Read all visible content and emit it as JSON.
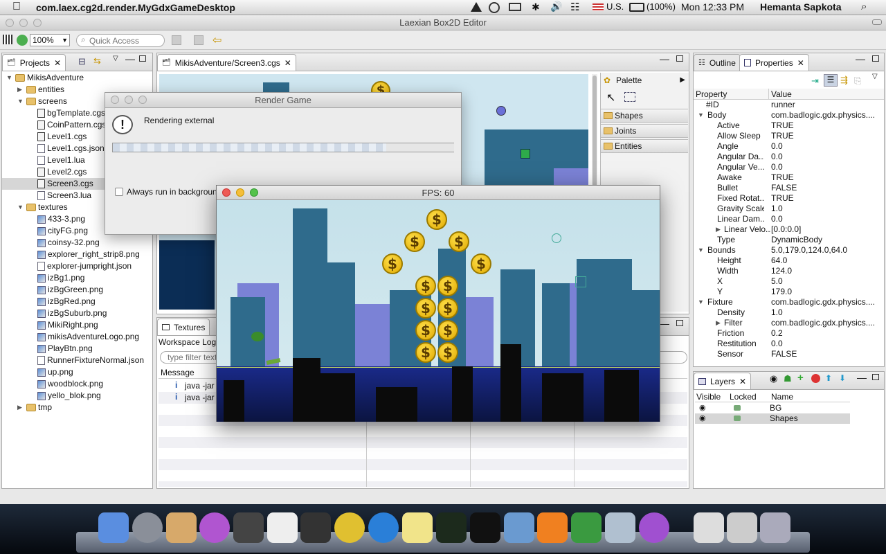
{
  "menubar": {
    "app_name": "com.laex.cg2d.render.MyGdxGameDesktop",
    "input_source": "U.S.",
    "battery": "(100%)",
    "clock": "Mon 12:33 PM",
    "user": "Hemanta Sapkota"
  },
  "window": {
    "title": "Laexian Box2D Editor"
  },
  "toolbar": {
    "zoom": "100%",
    "quick_access_placeholder": "Quick Access"
  },
  "projects": {
    "tab": "Projects",
    "tree": [
      {
        "label": "MikisAdventure",
        "level": 0,
        "type": "project",
        "expanded": true
      },
      {
        "label": "entities",
        "level": 1,
        "type": "folder",
        "expanded": false
      },
      {
        "label": "screens",
        "level": 1,
        "type": "folder",
        "expanded": true
      },
      {
        "label": "bgTemplate.cgs",
        "level": 2,
        "type": "cgs"
      },
      {
        "label": "CoinPattern.cgs",
        "level": 2,
        "type": "cgs"
      },
      {
        "label": "Level1.cgs",
        "level": 2,
        "type": "cgs"
      },
      {
        "label": "Level1.cgs.json",
        "level": 2,
        "type": "file"
      },
      {
        "label": "Level1.lua",
        "level": 2,
        "type": "file"
      },
      {
        "label": "Level2.cgs",
        "level": 2,
        "type": "cgs"
      },
      {
        "label": "Screen3.cgs",
        "level": 2,
        "type": "cgs",
        "selected": true
      },
      {
        "label": "Screen3.lua",
        "level": 2,
        "type": "file"
      },
      {
        "label": "textures",
        "level": 1,
        "type": "folder",
        "expanded": true
      },
      {
        "label": "433-3.png",
        "level": 2,
        "type": "image"
      },
      {
        "label": "cityFG.png",
        "level": 2,
        "type": "image"
      },
      {
        "label": "coinsy-32.png",
        "level": 2,
        "type": "image"
      },
      {
        "label": "explorer_right_strip8.png",
        "level": 2,
        "type": "image"
      },
      {
        "label": "explorer-jumpright.json",
        "level": 2,
        "type": "file"
      },
      {
        "label": "izBg1.png",
        "level": 2,
        "type": "image"
      },
      {
        "label": "izBgGreen.png",
        "level": 2,
        "type": "image"
      },
      {
        "label": "izBgRed.png",
        "level": 2,
        "type": "image"
      },
      {
        "label": "izBgSuburb.png",
        "level": 2,
        "type": "image"
      },
      {
        "label": "MikiRight.png",
        "level": 2,
        "type": "image"
      },
      {
        "label": "mikisAdventureLogo.png",
        "level": 2,
        "type": "image"
      },
      {
        "label": "PlayBtn.png",
        "level": 2,
        "type": "image"
      },
      {
        "label": "RunnerFixtureNormal.json",
        "level": 2,
        "type": "file"
      },
      {
        "label": "up.png",
        "level": 2,
        "type": "image"
      },
      {
        "label": "woodblock.png",
        "level": 2,
        "type": "image"
      },
      {
        "label": "yello_blok.png",
        "level": 2,
        "type": "image"
      },
      {
        "label": "tmp",
        "level": 1,
        "type": "folder",
        "expanded": false
      }
    ]
  },
  "editor": {
    "tab": "MikisAdventure/Screen3.cgs"
  },
  "palette": {
    "title": "Palette",
    "sections": [
      "Shapes",
      "Joints",
      "Entities"
    ]
  },
  "bottom": {
    "tab_textures": "Textures",
    "tab_workspace": "Workspace Log",
    "filter_placeholder": "type filter text",
    "col_message": "Message",
    "rows": [
      "java -jar",
      "java -jar"
    ]
  },
  "render_dialog": {
    "title": "Render Game",
    "message": "Rendering external",
    "checkbox": "Always run in background"
  },
  "game": {
    "title": "FPS: 60"
  },
  "outline": {
    "tab": "Outline"
  },
  "properties": {
    "tab": "Properties",
    "col_property": "Property",
    "col_value": "Value",
    "rows": [
      {
        "k": "#ID",
        "v": "runner",
        "level": 1
      },
      {
        "k": "Body",
        "v": "com.badlogic.gdx.physics....",
        "level": 0,
        "expander": "open"
      },
      {
        "k": "Active",
        "v": "TRUE",
        "level": 2
      },
      {
        "k": "Allow Sleep",
        "v": "TRUE",
        "level": 2
      },
      {
        "k": "Angle",
        "v": "0.0",
        "level": 2
      },
      {
        "k": "Angular Da...",
        "v": "0.0",
        "level": 2
      },
      {
        "k": "Angular Ve...",
        "v": "0.0",
        "level": 2
      },
      {
        "k": "Awake",
        "v": "TRUE",
        "level": 2
      },
      {
        "k": "Bullet",
        "v": "FALSE",
        "level": 2
      },
      {
        "k": "Fixed Rotat...",
        "v": "TRUE",
        "level": 2
      },
      {
        "k": "Gravity Scale",
        "v": "1.0",
        "level": 2
      },
      {
        "k": "Linear Dam...",
        "v": "0.0",
        "level": 2
      },
      {
        "k": "Linear Velo...",
        "v": "[0.0:0.0]",
        "level": 2,
        "expander": "closed"
      },
      {
        "k": "Type",
        "v": "DynamicBody",
        "level": 2
      },
      {
        "k": "Bounds",
        "v": "5.0,179.0,124.0,64.0",
        "level": 0,
        "expander": "open"
      },
      {
        "k": "Height",
        "v": "64.0",
        "level": 2
      },
      {
        "k": "Width",
        "v": "124.0",
        "level": 2
      },
      {
        "k": "X",
        "v": "5.0",
        "level": 2
      },
      {
        "k": "Y",
        "v": "179.0",
        "level": 2
      },
      {
        "k": "Fixture",
        "v": "com.badlogic.gdx.physics....",
        "level": 0,
        "expander": "open"
      },
      {
        "k": "Density",
        "v": "1.0",
        "level": 2
      },
      {
        "k": "Filter",
        "v": "com.badlogic.gdx.physics....",
        "level": 2,
        "expander": "closed"
      },
      {
        "k": "Friction",
        "v": "0.2",
        "level": 2
      },
      {
        "k": "Restitution",
        "v": "0.0",
        "level": 2
      },
      {
        "k": "Sensor",
        "v": "FALSE",
        "level": 2
      }
    ]
  },
  "layers": {
    "tab": "Layers",
    "col_visible": "Visible",
    "col_locked": "Locked",
    "col_name": "Name",
    "rows": [
      "BG",
      "Shapes"
    ]
  },
  "colors": {
    "selection": "#d6d6d6",
    "sky": "#cfe6f0",
    "building": "#2f6b8c",
    "ground": "#1a2a7a"
  }
}
